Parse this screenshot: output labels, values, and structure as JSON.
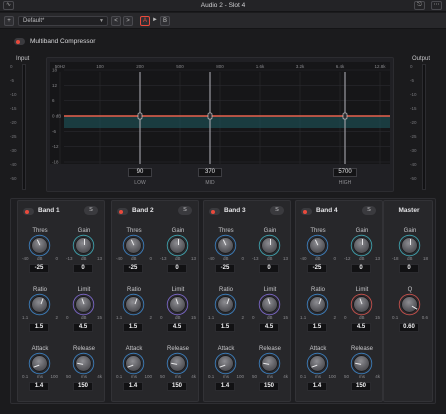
{
  "window": {
    "title": "Audio 2 - Slot 4"
  },
  "toolbar": {
    "add_label": "+",
    "preset_value": "Default*",
    "prev_label": "<",
    "next_label": ">",
    "a_label": "A",
    "arrow_label": "►",
    "b_label": "B"
  },
  "module": {
    "label": "Multiband Compressor",
    "enabled": true
  },
  "meters": {
    "input_label": "Input",
    "output_label": "Output",
    "ticks": [
      "0",
      "-5",
      "-10",
      "-15",
      "-20",
      "-25",
      "-30",
      "-40",
      "-50"
    ]
  },
  "graph": {
    "freq_ticks": [
      "50Hz",
      "100",
      "200",
      "500",
      "800",
      "1.6k",
      "3.2k",
      "6.4k",
      "12.8k"
    ],
    "db_ticks": [
      "18",
      "12",
      "6",
      "0 dB",
      "-6",
      "-12",
      "-18"
    ],
    "crossovers": [
      {
        "value": "90",
        "name": "LOW"
      },
      {
        "value": "370",
        "name": "MID"
      },
      {
        "value": "5700",
        "name": "HIGH"
      }
    ]
  },
  "bands": [
    {
      "name": "Band 1",
      "solo": "S",
      "thres": {
        "label": "Thres",
        "min": "-40",
        "unit": "dB",
        "max": "0",
        "value": "-25"
      },
      "gain": {
        "label": "Gain",
        "min": "-13",
        "unit": "dB",
        "max": "13",
        "value": "0"
      },
      "ratio": {
        "label": "Ratio",
        "min": "1.1",
        "max": "2",
        "value": "1.5"
      },
      "limit": {
        "label": "Limit",
        "min": "0",
        "unit": "dB",
        "max": "15",
        "value": "4.5"
      },
      "attack": {
        "label": "Attack",
        "min": "0.1",
        "unit": "ms",
        "max": "100",
        "value": "1.4"
      },
      "release": {
        "label": "Release",
        "min": "50",
        "unit": "ms",
        "max": "4k",
        "value": "150"
      }
    },
    {
      "name": "Band 2",
      "solo": "S",
      "thres": {
        "label": "Thres",
        "min": "-40",
        "unit": "dB",
        "max": "0",
        "value": "-25"
      },
      "gain": {
        "label": "Gain",
        "min": "-13",
        "unit": "dB",
        "max": "13",
        "value": "0"
      },
      "ratio": {
        "label": "Ratio",
        "min": "1.1",
        "max": "2",
        "value": "1.5"
      },
      "limit": {
        "label": "Limit",
        "min": "0",
        "unit": "dB",
        "max": "15",
        "value": "4.5"
      },
      "attack": {
        "label": "Attack",
        "min": "0.1",
        "unit": "ms",
        "max": "100",
        "value": "1.4"
      },
      "release": {
        "label": "Release",
        "min": "50",
        "unit": "ms",
        "max": "4k",
        "value": "150"
      }
    },
    {
      "name": "Band 3",
      "solo": "S",
      "thres": {
        "label": "Thres",
        "min": "-40",
        "unit": "dB",
        "max": "0",
        "value": "-25"
      },
      "gain": {
        "label": "Gain",
        "min": "-13",
        "unit": "dB",
        "max": "13",
        "value": "0"
      },
      "ratio": {
        "label": "Ratio",
        "min": "1.1",
        "max": "2",
        "value": "1.5"
      },
      "limit": {
        "label": "Limit",
        "min": "0",
        "unit": "dB",
        "max": "15",
        "value": "4.5"
      },
      "attack": {
        "label": "Attack",
        "min": "0.1",
        "unit": "ms",
        "max": "100",
        "value": "1.4"
      },
      "release": {
        "label": "Release",
        "min": "50",
        "unit": "ms",
        "max": "4k",
        "value": "150"
      }
    },
    {
      "name": "Band 4",
      "solo": "S",
      "thres": {
        "label": "Thres",
        "min": "-40",
        "unit": "dB",
        "max": "0",
        "value": "-25"
      },
      "gain": {
        "label": "Gain",
        "min": "-12",
        "unit": "dB",
        "max": "13",
        "value": "0"
      },
      "ratio": {
        "label": "Ratio",
        "min": "1.1",
        "max": "2",
        "value": "1.5"
      },
      "limit": {
        "label": "Limit",
        "min": "0",
        "unit": "dB",
        "max": "15",
        "value": "4.5"
      },
      "attack": {
        "label": "Attack",
        "min": "0.1",
        "unit": "ms",
        "max": "100",
        "value": "1.4"
      },
      "release": {
        "label": "Release",
        "min": "50",
        "unit": "ms",
        "max": "4k",
        "value": "150"
      }
    }
  ],
  "master": {
    "title": "Master",
    "gain": {
      "label": "Gain",
      "min": "-18",
      "unit": "dB",
      "max": "18",
      "value": "0"
    },
    "q": {
      "label": "Q",
      "min": "0.1",
      "max": "0.6",
      "value": "0.60"
    }
  },
  "colors": {
    "thres_ring": "#3d84c6",
    "gain_ring": "#3fa9b5",
    "limit_ring": "#7f6ad0",
    "limit_ring_band4": "#d1534d",
    "curve": "#e8604c",
    "band_fill": "#1f5d63",
    "power_on": "#e84a3c"
  }
}
